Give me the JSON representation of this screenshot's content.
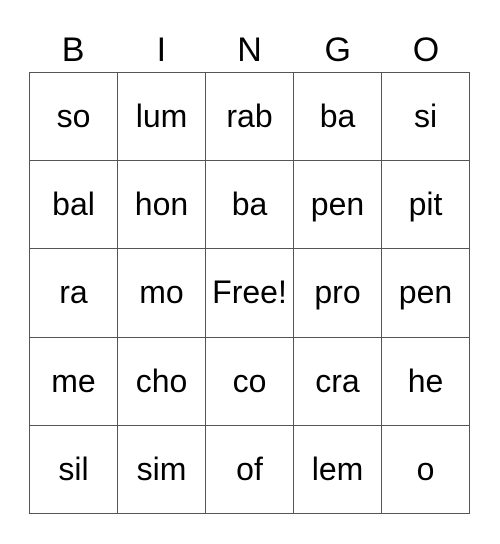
{
  "header": [
    "B",
    "I",
    "N",
    "G",
    "O"
  ],
  "rows": [
    [
      "so",
      "lum",
      "rab",
      "ba",
      "si"
    ],
    [
      "bal",
      "hon",
      "ba",
      "pen",
      "pit"
    ],
    [
      "ra",
      "mo",
      "Free!",
      "pro",
      "pen"
    ],
    [
      "me",
      "cho",
      "co",
      "cra",
      "he"
    ],
    [
      "sil",
      "sim",
      "of",
      "lem",
      "o"
    ]
  ]
}
